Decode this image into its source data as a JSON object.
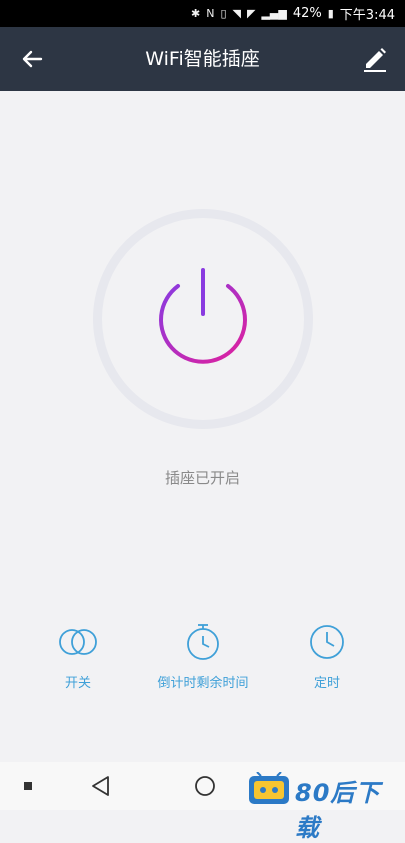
{
  "status_bar": {
    "battery": "42%",
    "time": "下午3:44",
    "icons": [
      "bluetooth-icon",
      "nfc-icon",
      "vibrate-icon",
      "wifi-icon",
      "no-sim-icon",
      "signal-icon",
      "battery-icon"
    ]
  },
  "app_bar": {
    "title": "WiFi智能插座",
    "back_icon": "arrow-left-icon",
    "edit_icon": "pencil-icon"
  },
  "power": {
    "icon": "power-icon",
    "status": "插座已开启",
    "is_on": true
  },
  "actions": [
    {
      "label": "开关",
      "icon": "toggle-circles-icon"
    },
    {
      "label": "倒计时剩余时间",
      "icon": "stopwatch-icon"
    },
    {
      "label": "定时",
      "icon": "clock-icon"
    }
  ],
  "colors": {
    "app_bar": "#2d3644",
    "background": "#f2f2f4",
    "accent_blue": "#3fa0d8",
    "power_gradient_start": "#8a3be0",
    "power_gradient_end": "#e0209c",
    "ring": "#e7e8ee",
    "status_text": "#8a8a8a"
  },
  "nav_bar": {
    "items": [
      "recent-apps-icon",
      "back-triangle-icon",
      "home-circle-icon"
    ]
  },
  "watermark": {
    "text": "80后下载",
    "icon": "robot-tv-icon"
  }
}
